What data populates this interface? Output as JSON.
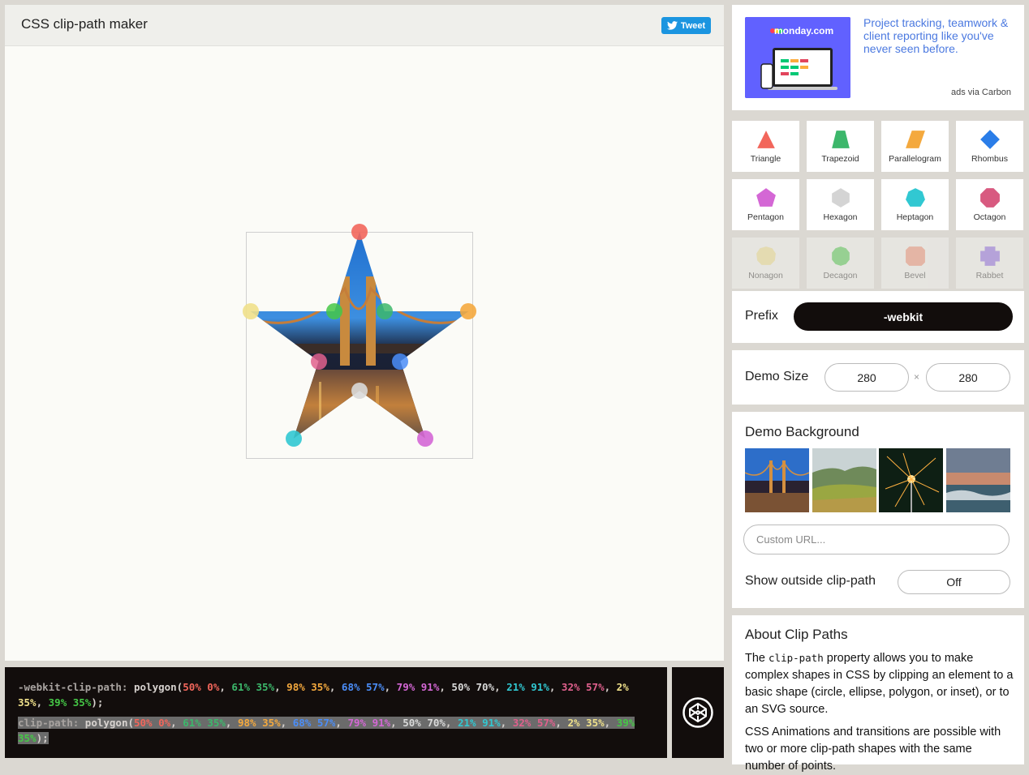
{
  "app": {
    "title": "CSS clip-path maker",
    "tweet_label": "Tweet"
  },
  "code": {
    "webkit_prop": "-webkit-clip-path:",
    "std_prop": "clip-path:",
    "fn_open": " polygon(",
    "fn_close": ");",
    "sep": ", ",
    "points": [
      {
        "text": "50% 0%",
        "color": "#f2665b"
      },
      {
        "text": "61% 35%",
        "color": "#3cb76b"
      },
      {
        "text": "98% 35%",
        "color": "#f4a93e"
      },
      {
        "text": "68% 57%",
        "color": "#4b8df8"
      },
      {
        "text": "79% 91%",
        "color": "#d467d5"
      },
      {
        "text": "50% 70%",
        "color": "#d9d9d9"
      },
      {
        "text": "21% 91%",
        "color": "#31c8d2"
      },
      {
        "text": "32% 57%",
        "color": "#e0608d"
      },
      {
        "text": "2% 35%",
        "color": "#efe08a"
      },
      {
        "text": "39% 35%",
        "color": "#45c746"
      }
    ]
  },
  "ad": {
    "brand": "monday.com",
    "text": "Project tracking, teamwork & client reporting like you've never seen before.",
    "via": "ads via Carbon"
  },
  "shapes": [
    {
      "label": "Triangle",
      "color": "#f2665b"
    },
    {
      "label": "Trapezoid",
      "color": "#3cb76b"
    },
    {
      "label": "Parallelogram",
      "color": "#f4a93e"
    },
    {
      "label": "Rhombus",
      "color": "#2a7de8"
    },
    {
      "label": "Pentagon",
      "color": "#d467d5"
    },
    {
      "label": "Hexagon",
      "color": "#d4d4d4"
    },
    {
      "label": "Heptagon",
      "color": "#31c8d2"
    },
    {
      "label": "Octagon",
      "color": "#d85a80"
    },
    {
      "label": "Nonagon",
      "color": "#efe08a"
    },
    {
      "label": "Decagon",
      "color": "#45c746"
    },
    {
      "label": "Bevel",
      "color": "#f08b6f"
    },
    {
      "label": "Rabbet",
      "color": "#8862e2"
    }
  ],
  "prefix": {
    "label": "Prefix",
    "value": "-webkit"
  },
  "demo_size": {
    "label": "Demo Size",
    "width": "280",
    "height": "280",
    "separator": "×"
  },
  "demo_background": {
    "label": "Demo Background",
    "thumbnails": [
      "bridge-night",
      "green-hills",
      "sparkler",
      "ocean-waves"
    ],
    "custom_url_placeholder": "Custom URL...",
    "show_outside_label": "Show outside clip-path",
    "show_outside_value": "Off"
  },
  "about": {
    "title": "About Clip Paths",
    "p1_before": "The ",
    "p1_code": "clip-path",
    "p1_after": " property allows you to make complex shapes in CSS by clipping an element to a basic shape (circle, ellipse, polygon, or inset), or to an SVG source.",
    "p2": "CSS Animations and transitions are possible with two or more clip-path shapes with the same number of points."
  }
}
